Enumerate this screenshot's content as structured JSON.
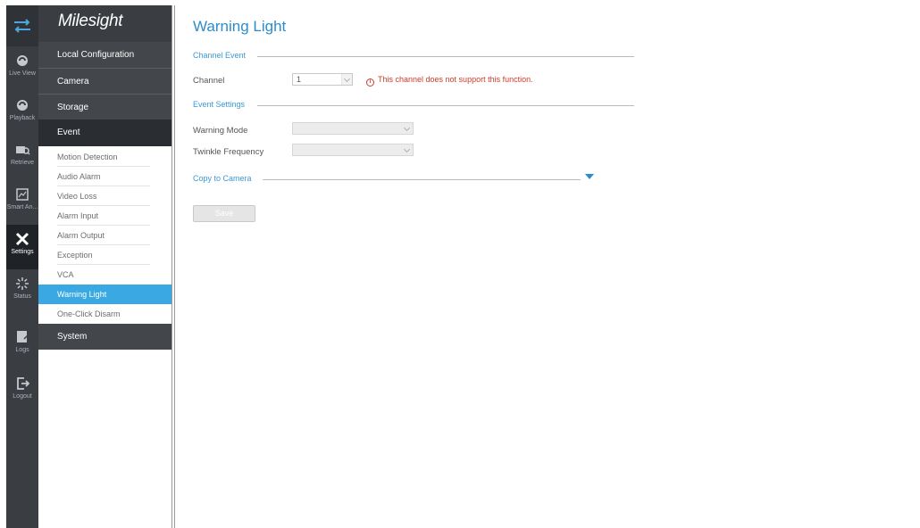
{
  "rail": {
    "items": [
      {
        "label": "Live View",
        "icon": "live-view-icon"
      },
      {
        "label": "Playback",
        "icon": "playback-icon"
      },
      {
        "label": "Retrieve",
        "icon": "retrieve-icon"
      },
      {
        "label": "Smart An...",
        "icon": "smart-analysis-icon"
      },
      {
        "label": "Settings",
        "icon": "settings-icon"
      },
      {
        "label": "Status",
        "icon": "status-icon"
      },
      {
        "label": "Logs",
        "icon": "logs-icon"
      },
      {
        "label": "Logout",
        "icon": "logout-icon"
      }
    ]
  },
  "brand": {
    "name": "Milesight"
  },
  "menu": {
    "local_configuration": "Local Configuration",
    "camera": "Camera",
    "storage": "Storage",
    "event": "Event",
    "system": "System",
    "event_items": [
      "Motion Detection",
      "Audio Alarm",
      "Video Loss",
      "Alarm Input",
      "Alarm Output",
      "Exception",
      "VCA",
      "Warning Light",
      "One-Click Disarm"
    ]
  },
  "page": {
    "title": "Warning Light",
    "channel_event_section": "Channel Event",
    "channel_label": "Channel",
    "channel_value": "1",
    "channel_warning": "This channel does not support this function.",
    "event_settings_section": "Event Settings",
    "warning_mode_label": "Warning Mode",
    "warning_mode_value": "",
    "twinkle_frequency_label": "Twinkle Frequency",
    "twinkle_frequency_value": "",
    "copy_to_camera": "Copy to Camera",
    "save_label": "Save"
  },
  "colors": {
    "accent": "#3aa9e3",
    "title": "#2d8ccc",
    "error": "#d03a2a",
    "rail": "#3a3d42"
  }
}
